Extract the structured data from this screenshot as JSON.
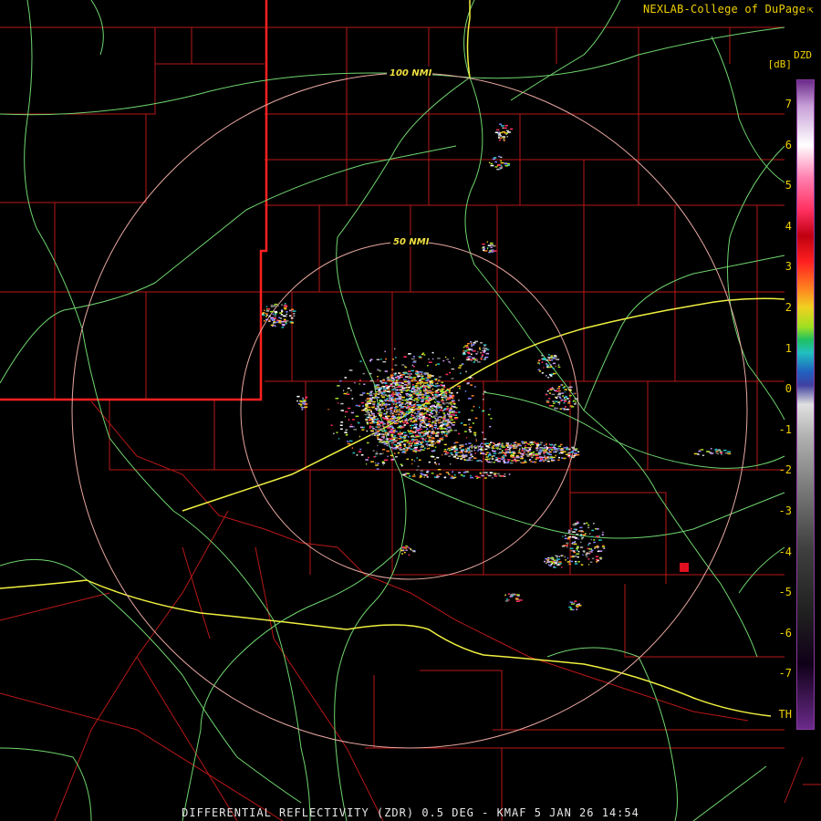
{
  "brand": {
    "text": "NEXLAB-College of DuPage",
    "ext_icon": "external-link-icon"
  },
  "product_label": "DIFFERENTIAL REFLECTIVITY (ZDR) 0.5 DEG - KMAF 5 JAN 26 14:54",
  "range_rings": [
    {
      "label": "100 NMI"
    },
    {
      "label": "50 NMI"
    }
  ],
  "scale": {
    "title": "DZD",
    "unit": "[dB]",
    "ticks": [
      "7",
      "6",
      "5",
      "4",
      "3",
      "2",
      "1",
      "0",
      "-1",
      "-2",
      "-3",
      "-4",
      "-5",
      "-6",
      "-7",
      "TH"
    ]
  },
  "colors": {
    "background": "#000000",
    "county_lines": "#c01818",
    "state_line": "#ff2020",
    "roads": "#7de07d",
    "interstates": "#f0f040",
    "range_rings": "#e8a8a0",
    "label_yellow": "#f0d000"
  }
}
